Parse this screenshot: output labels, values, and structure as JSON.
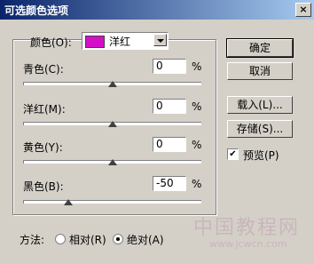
{
  "window": {
    "title": "可选颜色选项"
  },
  "colors_label": "颜色(O):",
  "colors_value": "洋红",
  "swatch_color": "#d40fc6",
  "sliders": [
    {
      "label": "青色(C):",
      "value": "0",
      "unit": "%"
    },
    {
      "label": "洋红(M):",
      "value": "0",
      "unit": "%"
    },
    {
      "label": "黄色(Y):",
      "value": "0",
      "unit": "%"
    },
    {
      "label": "黑色(B):",
      "value": "-50",
      "unit": "%"
    }
  ],
  "buttons": {
    "ok": "确定",
    "cancel": "取消",
    "load": "载入(L)...",
    "save": "存储(S)..."
  },
  "preview": {
    "label": "预览(P)",
    "checked": true
  },
  "method": {
    "label": "方法:",
    "relative": "相对(R)",
    "absolute": "绝对(A)",
    "selected": "absolute"
  },
  "watermark": {
    "main": "中国教程网",
    "url": "www.jcwcn.com"
  }
}
